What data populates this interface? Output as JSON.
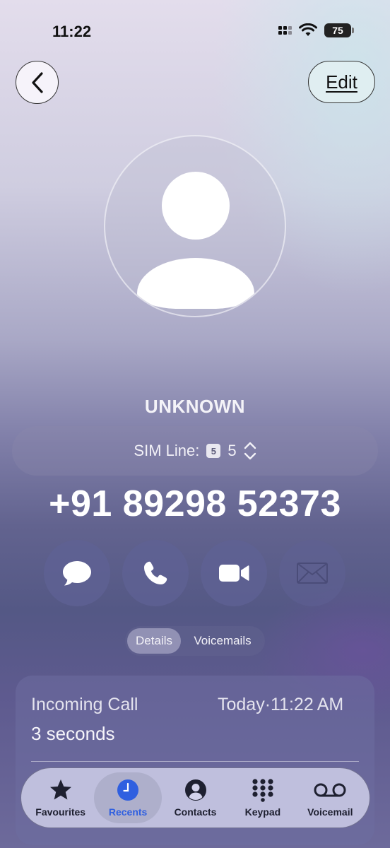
{
  "status_bar": {
    "time": "11:22",
    "battery": "75"
  },
  "header": {
    "edit_label": "Edit"
  },
  "contact": {
    "name": "UNKNOWN",
    "phone": "+91 89298 52373"
  },
  "sim": {
    "label": "SIM Line:",
    "badge": "5",
    "value": "5"
  },
  "actions": [
    {
      "name": "message",
      "icon": "message-bubble-icon"
    },
    {
      "name": "call",
      "icon": "phone-icon"
    },
    {
      "name": "video",
      "icon": "video-camera-icon"
    },
    {
      "name": "mail",
      "icon": "envelope-icon",
      "disabled": true
    }
  ],
  "segments": {
    "details": "Details",
    "voicemails": "Voicemails",
    "selected": "Details"
  },
  "call_log": {
    "type": "Incoming Call",
    "time": "Today·11:22 AM",
    "duration": "3 seconds"
  },
  "tabs": [
    {
      "label": "Favourites",
      "icon": "star-icon"
    },
    {
      "label": "Recents",
      "icon": "clock-icon",
      "active": true
    },
    {
      "label": "Contacts",
      "icon": "person-circle-icon"
    },
    {
      "label": "Keypad",
      "icon": "keypad-icon"
    },
    {
      "label": "Voicemail",
      "icon": "voicemail-icon"
    }
  ],
  "colors": {
    "active_tab": "#2f5fe0",
    "action_button": "#5f6194"
  }
}
